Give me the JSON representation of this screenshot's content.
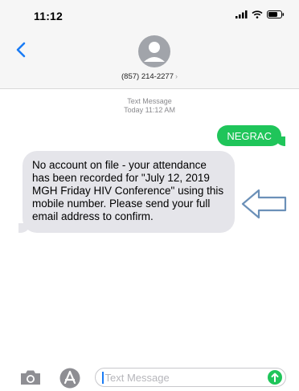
{
  "status_bar": {
    "time": "11:12"
  },
  "header": {
    "contact": "(857) 214-2277",
    "chevron": "›"
  },
  "thread": {
    "service_label": "Text Message",
    "timestamp": "Today 11:12 AM",
    "outgoing": [
      {
        "text": "NEGRAC"
      }
    ],
    "incoming": [
      {
        "text": "No account on file - your attendance has been recorded for \"July 12, 2019 MGH Friday HIV Conference\" using this mobile number. Please send your full email address to confirm."
      }
    ]
  },
  "composer": {
    "placeholder": "Text Message"
  },
  "icons": {
    "back": "chevron-left-icon",
    "avatar": "person-icon",
    "signal": "signal-icon",
    "wifi": "wifi-icon",
    "battery": "battery-icon",
    "camera": "camera-icon",
    "apps": "app-store-icon",
    "send": "arrow-up-icon",
    "annotation": "left-arrow-icon"
  },
  "colors": {
    "accent": "#1a7cf5",
    "sent_bubble": "#1fc55a",
    "received_bubble": "#e5e5ea",
    "annotation_arrow": "#6b90b8"
  }
}
